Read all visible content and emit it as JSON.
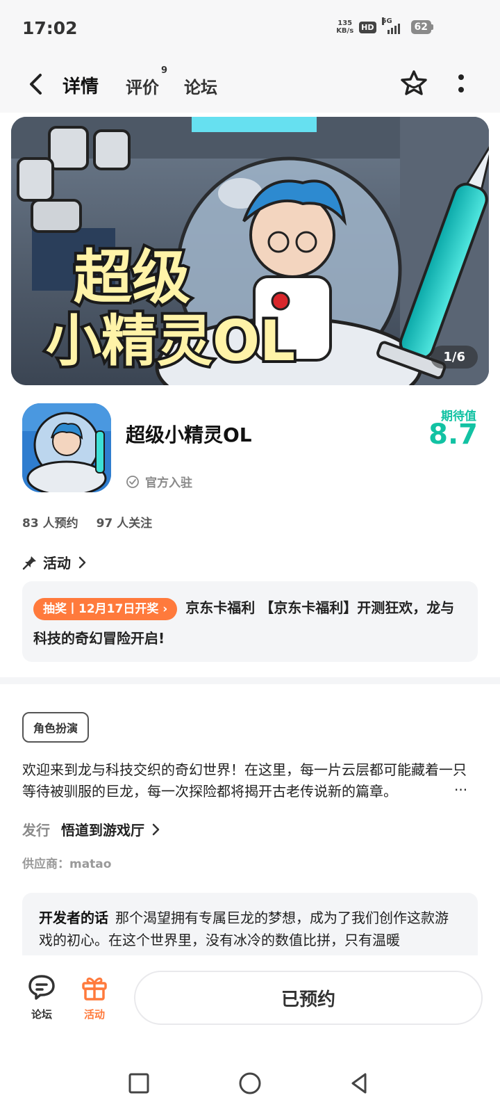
{
  "status_bar": {
    "time": "17:02",
    "net_speed_value": "135",
    "net_speed_unit": "KB/s",
    "hd": "HD",
    "network": "5G",
    "battery": "62"
  },
  "nav": {
    "tabs": [
      {
        "label": "详情",
        "active": true
      },
      {
        "label": "评价",
        "badge": "9"
      },
      {
        "label": "论坛"
      }
    ]
  },
  "banner": {
    "title_line1": "超级",
    "title_line2": "小精灵OL",
    "counter": "1/6"
  },
  "app": {
    "title": "超级小精灵OL",
    "official_label": "官方入驻",
    "expect_label": "期待值",
    "expect_score": "8.7"
  },
  "stats": {
    "reservations": "83 人预约",
    "followers": "97 人关注"
  },
  "activity": {
    "header": "活动",
    "badge": "抽奖丨12月17日开奖",
    "text": "京东卡福利 【京东卡福利】开测狂欢，龙与科技的奇幻冒险开启!"
  },
  "details": {
    "genre": "角色扮演",
    "description": "欢迎来到龙与科技交织的奇幻世界！在这里，每一片云层都可能藏着一只等待被驯服的巨龙，每一次探险都将揭开古老传说新的篇章。",
    "ellipsis": "···",
    "publisher_label": "发行",
    "publisher_name": "悟道到游戏厅",
    "supplier": "供应商：matao"
  },
  "developer": {
    "title": "开发者的话",
    "text": "那个渴望拥有专属巨龙的梦想，成为了我们创作这款游戏的初心。在这个世界里，没有冰冷的数值比拼，只有温暖"
  },
  "bottom_bar": {
    "forum_label": "论坛",
    "activity_label": "活动",
    "reserve_button": "已预约"
  },
  "colors": {
    "accent": "#12c2a3",
    "tab_underline": "#19d1b5",
    "orange": "#ff7a3c"
  }
}
